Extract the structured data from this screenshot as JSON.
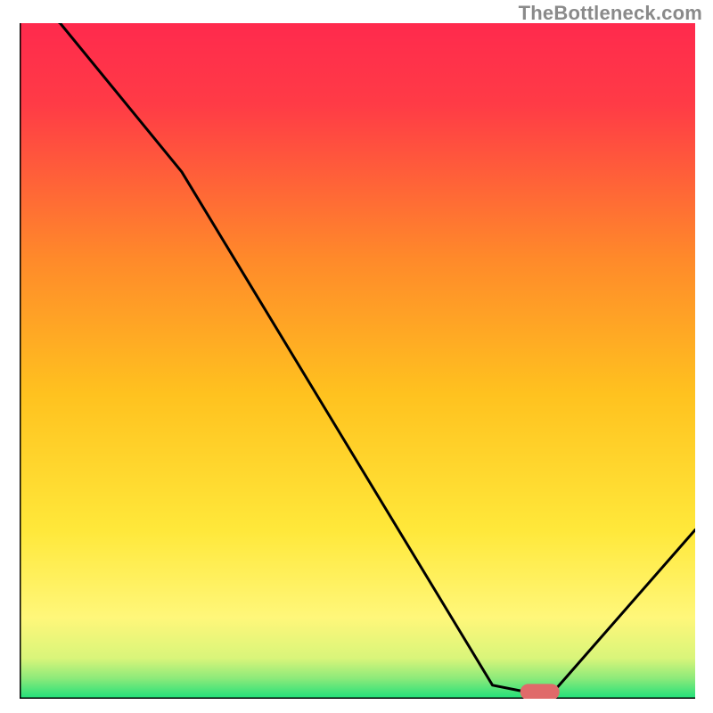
{
  "attribution": "TheBottleneck.com",
  "colors": {
    "gradient_top": "#ff2a4d",
    "gradient_mid": "#ffd11a",
    "gradient_yellow_light": "#fff77a",
    "gradient_green": "#1ee07a",
    "curve": "#000000",
    "marker": "#e06a6a",
    "axis": "#000000"
  },
  "chart_data": {
    "type": "line",
    "title": "",
    "xlabel": "",
    "ylabel": "",
    "xlim": [
      0,
      100
    ],
    "ylim": [
      0,
      100
    ],
    "x": [
      0,
      6,
      24,
      70,
      75,
      79,
      100
    ],
    "values": [
      104,
      100,
      78,
      2,
      1,
      1,
      25
    ],
    "marker_point": {
      "x": 77,
      "y": 1
    },
    "annotations": [],
    "legend": []
  }
}
